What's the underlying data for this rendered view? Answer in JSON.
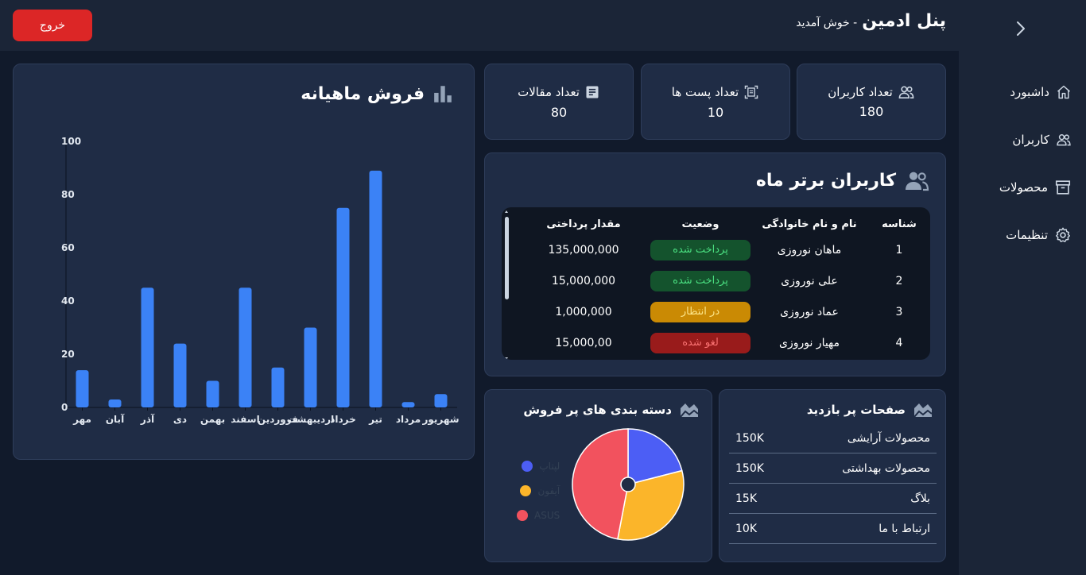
{
  "header": {
    "title": "پنل ادمین",
    "subtitle": "- خوش آمدید",
    "logout_label": "خروج"
  },
  "sidebar": {
    "toggle_icon": "chevron-right-icon",
    "items": [
      {
        "label": "داشبورد",
        "icon": "home-icon"
      },
      {
        "label": "کاربران",
        "icon": "users-icon"
      },
      {
        "label": "محصولات",
        "icon": "archive-icon"
      },
      {
        "label": "تنظیمات",
        "icon": "gear-icon"
      }
    ]
  },
  "stats": [
    {
      "label": "تعداد کاربران",
      "value": "180",
      "icon": "users-icon"
    },
    {
      "label": "تعداد پست ها",
      "value": "10",
      "icon": "post-icon"
    },
    {
      "label": "تعداد مقالات",
      "value": "80",
      "icon": "article-icon"
    }
  ],
  "top_users": {
    "title": "کاربران برتر ماه",
    "columns": [
      "شناسه",
      "نام و نام خانوادگی",
      "وضعیت",
      "مقدار پرداختی"
    ],
    "rows": [
      {
        "id": "1",
        "name": "ماهان نوروزی",
        "status": "پرداخت شده",
        "status_type": "paid",
        "amount": "135,000,000"
      },
      {
        "id": "2",
        "name": "علی نوروزی",
        "status": "پرداخت شده",
        "status_type": "paid",
        "amount": "15,000,000"
      },
      {
        "id": "3",
        "name": "عماد نوروزی",
        "status": "در انتظار",
        "status_type": "pending",
        "amount": "1,000,000"
      },
      {
        "id": "4",
        "name": "مهیار نوروزی",
        "status": "لغو شده",
        "status_type": "cancel",
        "amount": "15,000,00"
      }
    ]
  },
  "monthly_sales": {
    "title": "فروش ماهیانه",
    "icon": "bar-chart-icon"
  },
  "chart_data": [
    {
      "type": "bar",
      "title": "فروش ماهیانه",
      "categories": [
        "مهر",
        "آبان",
        "آذر",
        "دی",
        "بهمن",
        "اسفند",
        "فروردین",
        "اردیبهشت",
        "خرداد",
        "تیر",
        "مرداد",
        "شهریور"
      ],
      "values": [
        14,
        3,
        45,
        24,
        10,
        45,
        15,
        30,
        75,
        89,
        2,
        5
      ],
      "ylim": [
        0,
        100
      ],
      "yticks": [
        0,
        20,
        40,
        60,
        80,
        100
      ],
      "color": "#3b82f6"
    },
    {
      "type": "pie",
      "title": "دسته بندی های پر فروش",
      "labels": [
        "لپتاپ",
        "آیفون",
        "ASUS"
      ],
      "values": [
        21,
        32,
        47
      ],
      "colors": [
        "#4c5ef5",
        "#fbb52a",
        "#f2525e"
      ]
    }
  ],
  "categories_card": {
    "title": "دسته بندی های پر فروش",
    "icon": "area-chart-icon"
  },
  "visited_pages": {
    "title": "صفحات پر بازدید",
    "icon": "area-chart-icon",
    "rows": [
      {
        "name": "محصولات آرایشی",
        "value": "150K"
      },
      {
        "name": "محصولات بهداشتی",
        "value": "150K"
      },
      {
        "name": "بلاگ",
        "value": "15K"
      },
      {
        "name": "ارتباط با ما",
        "value": "10K"
      }
    ]
  }
}
